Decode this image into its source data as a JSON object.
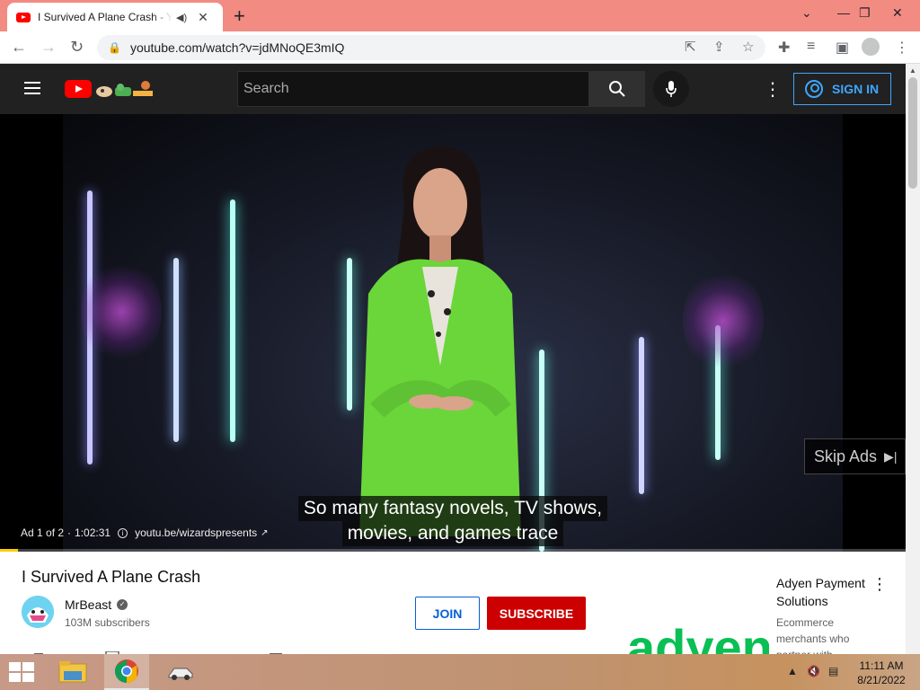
{
  "browser": {
    "tab_title": "I Survived A Plane Crash - YouTube",
    "new_tab_icon": "plus-icon",
    "url": "youtube.com/watch?v=jdMNoQE3mIQ"
  },
  "yt_header": {
    "search_placeholder": "Search",
    "signin_label": "SIGN IN"
  },
  "player": {
    "captions": [
      "So many fantasy novels, TV shows,",
      "movies, and games trace"
    ],
    "ad_counter": "Ad 1 of 2",
    "ad_time": "1:02:31",
    "ad_link": "youtu.be/wizardspresents",
    "skip_label": "Skip Ads",
    "progress_fraction": 0.02,
    "progress_color": "#ffcc00"
  },
  "video": {
    "title": "I Survived A Plane Crash",
    "channel": "MrBeast",
    "subscribers": "103M subscribers",
    "join_label": "JOIN",
    "subscribe_label": "SUBSCRIBE"
  },
  "sidebar_ad": {
    "title": "Adyen Payment Solutions",
    "description": "Ecommerce merchants who partner with",
    "logo_text": "adyen"
  },
  "taskbar": {
    "time": "11:11 AM",
    "date": "8/21/2022"
  },
  "colors": {
    "tabbar": "#f28b82",
    "yt_red": "#ff0000",
    "subscribe": "#cc0000",
    "link_blue": "#065fd4",
    "signin_blue": "#3ea6ff"
  }
}
